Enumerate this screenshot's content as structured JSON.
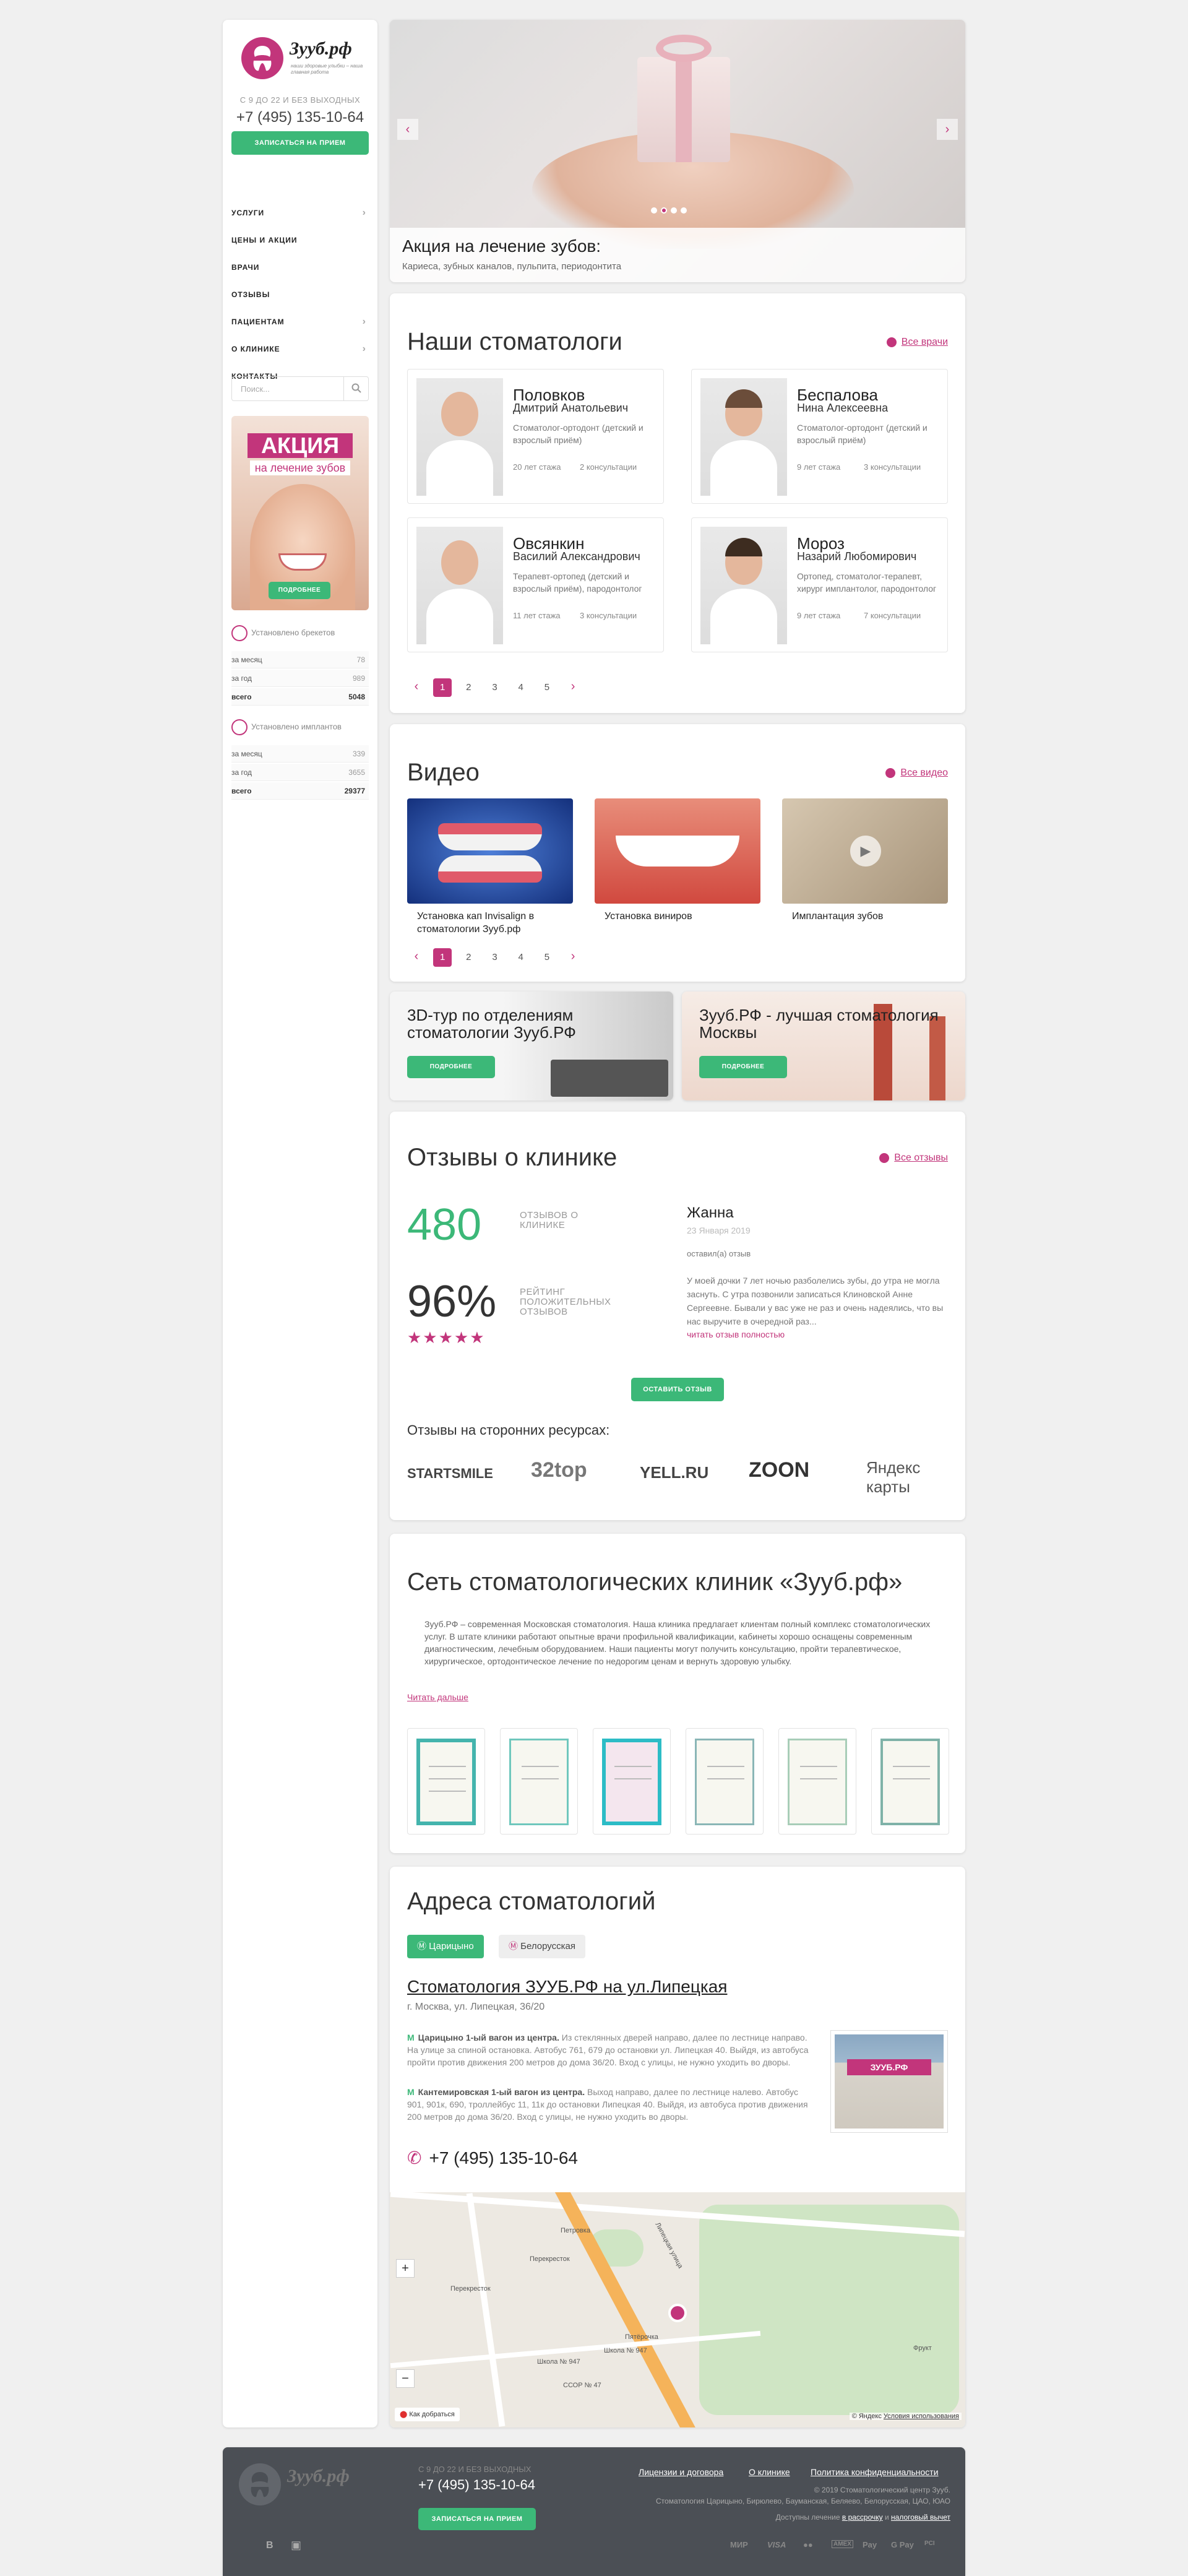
{
  "sidebar": {
    "logo_text": "Зууб.рф",
    "logo_tagline": "наши здоровые улыбки – наша главная работа",
    "hours": "С 9 ДО 22 И БЕЗ ВЫХОДНЫХ",
    "phone": "+7 (495) 135-10-64",
    "appointment_button": "Записаться на прием",
    "menu": [
      {
        "label": "УСЛУГИ",
        "arrow": true
      },
      {
        "label": "ЦЕНЫ И АКЦИИ",
        "arrow": false
      },
      {
        "label": "ВРАЧИ",
        "arrow": false
      },
      {
        "label": "ОТЗЫВЫ",
        "arrow": false
      },
      {
        "label": "ПАЦИЕНТАМ",
        "arrow": true
      },
      {
        "label": "О КЛИНИКЕ",
        "arrow": true
      },
      {
        "label": "КОНТАКТЫ",
        "arrow": false
      }
    ],
    "search_placeholder": "Поиск...",
    "promo": {
      "title": "АКЦИЯ",
      "subtitle": "на лечение зубов",
      "button": "Подробнее"
    },
    "braces": {
      "heading": "Установлено брекетов",
      "rows": [
        {
          "label": "за месяц",
          "value": "78"
        },
        {
          "label": "за год",
          "value": "989"
        },
        {
          "label": "всего",
          "value": "5048"
        }
      ]
    },
    "implants": {
      "heading": "Установлено имплантов",
      "rows": [
        {
          "label": "за месяц",
          "value": "339"
        },
        {
          "label": "за год",
          "value": "3655"
        },
        {
          "label": "всего",
          "value": "29377"
        }
      ]
    }
  },
  "hero": {
    "title": "Акция на лечение зубов:",
    "subtitle": "Кариеса, зубных каналов, пульпита, периодонтита",
    "prev": "‹",
    "next": "›",
    "slides_count": 4,
    "active_slide": 2
  },
  "doctors": {
    "title": "Наши стоматологи",
    "all_link": "Все врачи",
    "cards": [
      {
        "surname": "Половков",
        "name": "Дмитрий Анатольевич",
        "desc": "Стоматолог-ортодонт (детский и взрослый приём)",
        "experience": "20 лет стажа",
        "consultations": "2 консультации"
      },
      {
        "surname": "Беспалова",
        "name": "Нина Алексеевна",
        "desc": "Стоматолог-ортодонт (детский и взрослый приём)",
        "experience": "9 лет стажа",
        "consultations": "3 консультации"
      },
      {
        "surname": "Овсянкин",
        "name": "Василий Александрович",
        "desc": "Терапевт-ортопед (детский и взрослый приём), пародонтолог",
        "experience": "11 лет стажа",
        "consultations": "3 консультации"
      },
      {
        "surname": "Мороз",
        "name": "Назарий Любомирович",
        "desc": "Ортопед, стоматолог-терапевт, хирург имплантолог, пародонтолог",
        "experience": "9 лет стажа",
        "consultations": "7 консультации"
      }
    ],
    "pages": [
      "1",
      "2",
      "3",
      "4",
      "5"
    ]
  },
  "video": {
    "title": "Видео",
    "all_link": "Все видео",
    "items": [
      "Установка кап Invisalign в стоматологии Зууб.рф",
      "Установка виниров",
      "Имплантация зубов"
    ],
    "pages": [
      "1",
      "2",
      "3",
      "4",
      "5"
    ]
  },
  "banners": [
    {
      "title": "3D-тур по отделениям стоматологии Зууб.РФ",
      "button": "Подробнее"
    },
    {
      "title": "Зууб.РФ - лучшая стоматология Москвы",
      "button": "Подробнее"
    }
  ],
  "reviews": {
    "title": "Отзывы о клинике",
    "all_link": "Все отзывы",
    "count": "480",
    "count_label": "ОТЗЫВОВ О КЛИНИКЕ",
    "rating": "96%",
    "rating_label": "РЕЙТИНГ ПОЛОЖИТЕЛЬНЫХ ОТЗЫВОВ",
    "stars": "★★★★★",
    "latest": {
      "name": "Жанна",
      "date": "23 Января 2019",
      "who": "оставил(а) отзыв",
      "text": "У моей дочки 7 лет ночью разболелись зубы, до утра не могла заснуть. С утра позвонили записаться Клиновской Анне Сергеевне. Бывали у вас уже не раз и очень надеялись, что вы нас выручите в очередной раз...",
      "more": "читать отзыв полностью"
    },
    "leave_button": "Оставить отзыв",
    "third_party_title": "Отзывы на сторонних ресурсах:",
    "third_party": [
      "STARTSMILE",
      "32top",
      "YELL.RU",
      "ZOON",
      "Яндекс карты"
    ]
  },
  "network": {
    "title": "Сеть стоматологических клиник «Зууб.рф»",
    "text": "Зууб.РФ – современная Московская стоматология. Наша клиника предлагает клиентам полный комплекс стоматологических услуг. В штате клиники работают опытные врачи профильной квалификации, кабинеты хорошо оснащены современным диагностическим, лечебным оборудованием. Наши пациенты могут получить консультацию, пройти терапевтическое, хирургическое, ортодонтическое лечение по недорогим ценам и вернуть здоровую улыбку.",
    "more_link": "Читать дальше"
  },
  "addresses": {
    "title": "Адреса стоматологий",
    "tabs": [
      "Царицыно",
      "Белорусская"
    ],
    "clinic_name": "Стоматология ЗУУБ.РФ на ул.Липецкая",
    "city": "г. Москва, ул. Липецкая, 36/20",
    "route1_bold": "Царицыно 1-ый вагон из центра.",
    "route1": "Из стеклянных дверей направо, далее по лестнице направо. На улице за спиной остановка. Автобус 761, 679 до остановки ул. Липецкая 40. Выйдя, из автобуса пройти против движения 200 метров до дома 36/20. Вход с улицы, не нужно уходить во дворы.",
    "route2_bold": "Кантемировская 1-ый вагон из центра.",
    "route2": "Выход направо, далее по лестнице налево. Автобус 901, 901к, 690, троллейбус 11, 11к до остановки Липецкая 40. Выйдя, из автобуса против движения 200 метров до дома 36/20. Вход с улицы, не нужно уходить во дворы.",
    "phone": "+7 (495) 135-10-64",
    "photo_sign": "ЗУУБ.РФ",
    "map": {
      "labels": [
        "Петровка",
        "Перекресток",
        "Перекресток",
        "Пятёрочка",
        "Школа № 947",
        "Школа № 947",
        "ССОР № 47",
        "Липецкая улица",
        "Фрукт",
        "Как добраться"
      ],
      "copyright": "© Яндекс",
      "terms": "Условия использования"
    }
  },
  "footer": {
    "logo_text": "Зууб.рф",
    "hours": "С 9 ДО 22 И БЕЗ ВЫХОДНЫХ",
    "phone": "+7 (495) 135-10-64",
    "button": "Записаться на прием",
    "links": [
      "Лицензии и договора",
      "О клинике",
      "Политика конфиденциальности"
    ],
    "copyright": "© 2019 Стоматологический центр Зууб.",
    "areas": "Стоматология Царицыно, Бирюлево, Бауманская, Беляево, Белорусская, ЦАО, ЮАО",
    "installment_pre": "Доступны лечение",
    "installment_link": "в рассрочку",
    "and": "и",
    "tax_link": "налоговый вычет",
    "payments": [
      "МИР",
      "VISA",
      "●●",
      "AMEX",
      "Pay",
      "G Pay",
      "PCI"
    ],
    "social": [
      "В",
      "▣"
    ]
  },
  "colors": {
    "accent": "#c2357b",
    "green": "#3cb878",
    "footer_bg": "#4b4f55"
  }
}
